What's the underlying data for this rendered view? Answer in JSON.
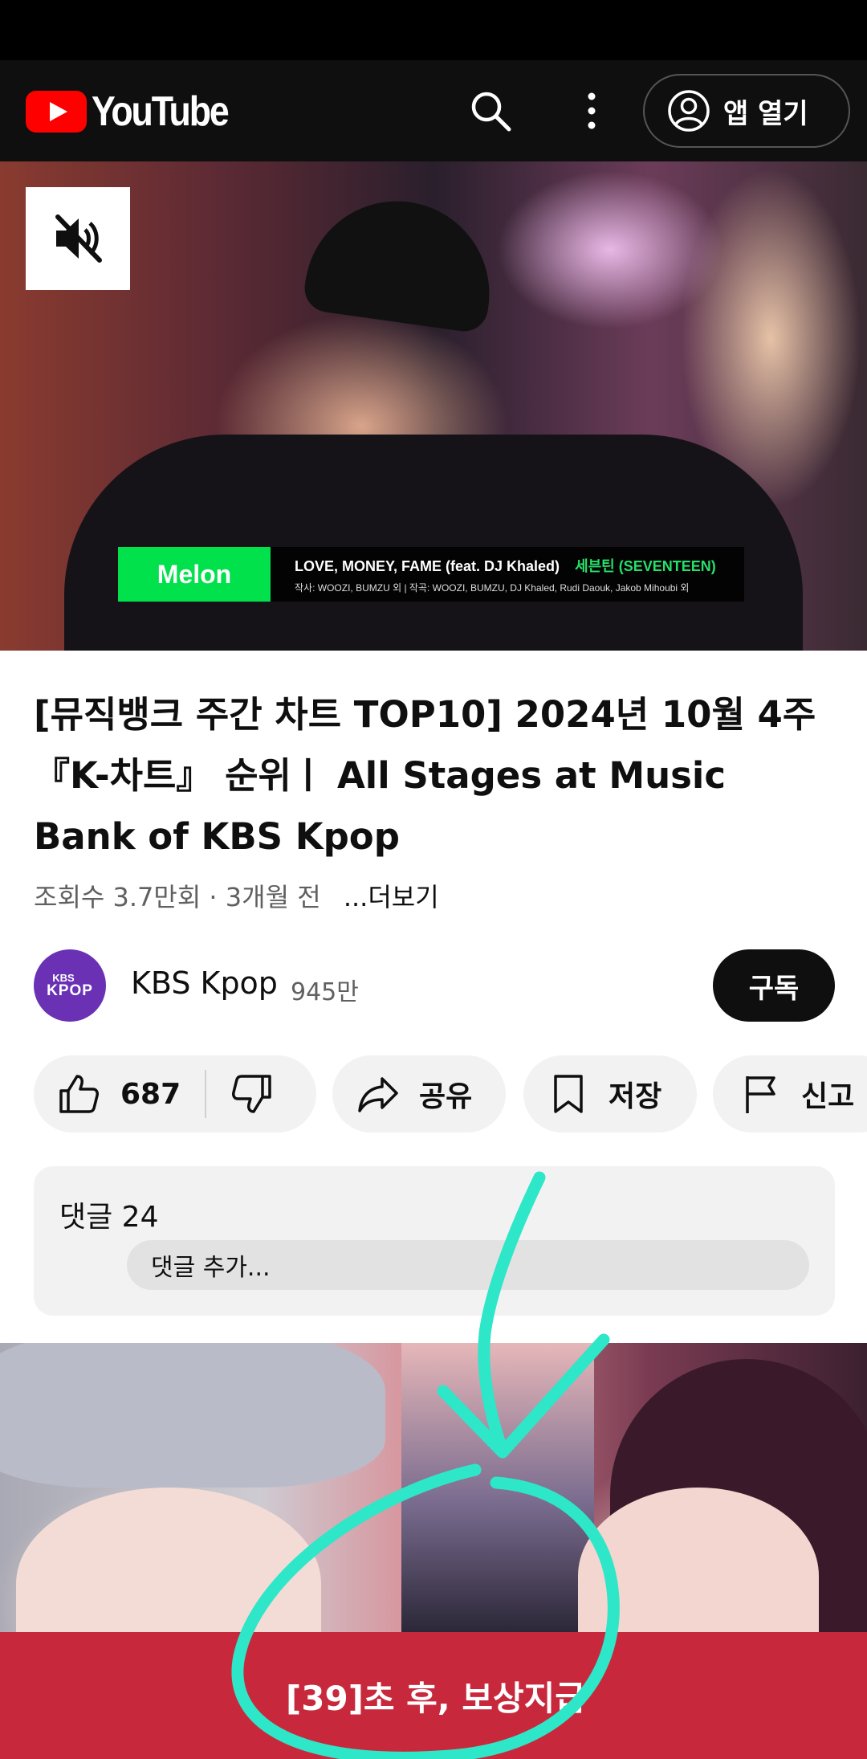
{
  "header": {
    "logo_text": "YouTube",
    "open_app_label": "앱 열기"
  },
  "video": {
    "melon_logo": "Melon",
    "song_title": "LOVE, MONEY, FAME (feat. DJ Khaled)",
    "artist": "세븐틴 (SEVENTEEN)",
    "credits": "작사: WOOZI, BUMZU 외 | 작곡: WOOZI, BUMZU, DJ Khaled, Rudi Daouk, Jakob Mihoubi 외"
  },
  "title": "[뮤직뱅크 주간 차트 TOP10] 2024년 10월 4주 『K-차트』 순위ㅣ All Stages at Music Bank of KBS Kpop",
  "meta": {
    "views": "조회수 3.7만회 · 3개월 전",
    "more": "...더보기"
  },
  "channel": {
    "avatar_top": "KBS",
    "avatar_bottom": "KPOP",
    "name": "KBS Kpop",
    "subscribers": "945만",
    "subscribe_label": "구독"
  },
  "actions": {
    "like_count": "687",
    "share_label": "공유",
    "save_label": "저장",
    "report_label": "신고"
  },
  "comments": {
    "title": "댓글 24",
    "placeholder": "댓글 추가..."
  },
  "ad": {
    "reward_text": "[39]초 후, 보상지급"
  },
  "colors": {
    "youtube_red": "#ff0000",
    "melon_green": "#00e14b",
    "reward_bar": "#c8283c",
    "annotation": "#2ee6c8"
  },
  "icons": [
    "youtube-logo-icon",
    "search-icon",
    "more-vert-icon",
    "account-icon",
    "mute-icon",
    "thumb-up-icon",
    "thumb-down-icon",
    "share-icon",
    "bookmark-icon",
    "flag-icon"
  ]
}
